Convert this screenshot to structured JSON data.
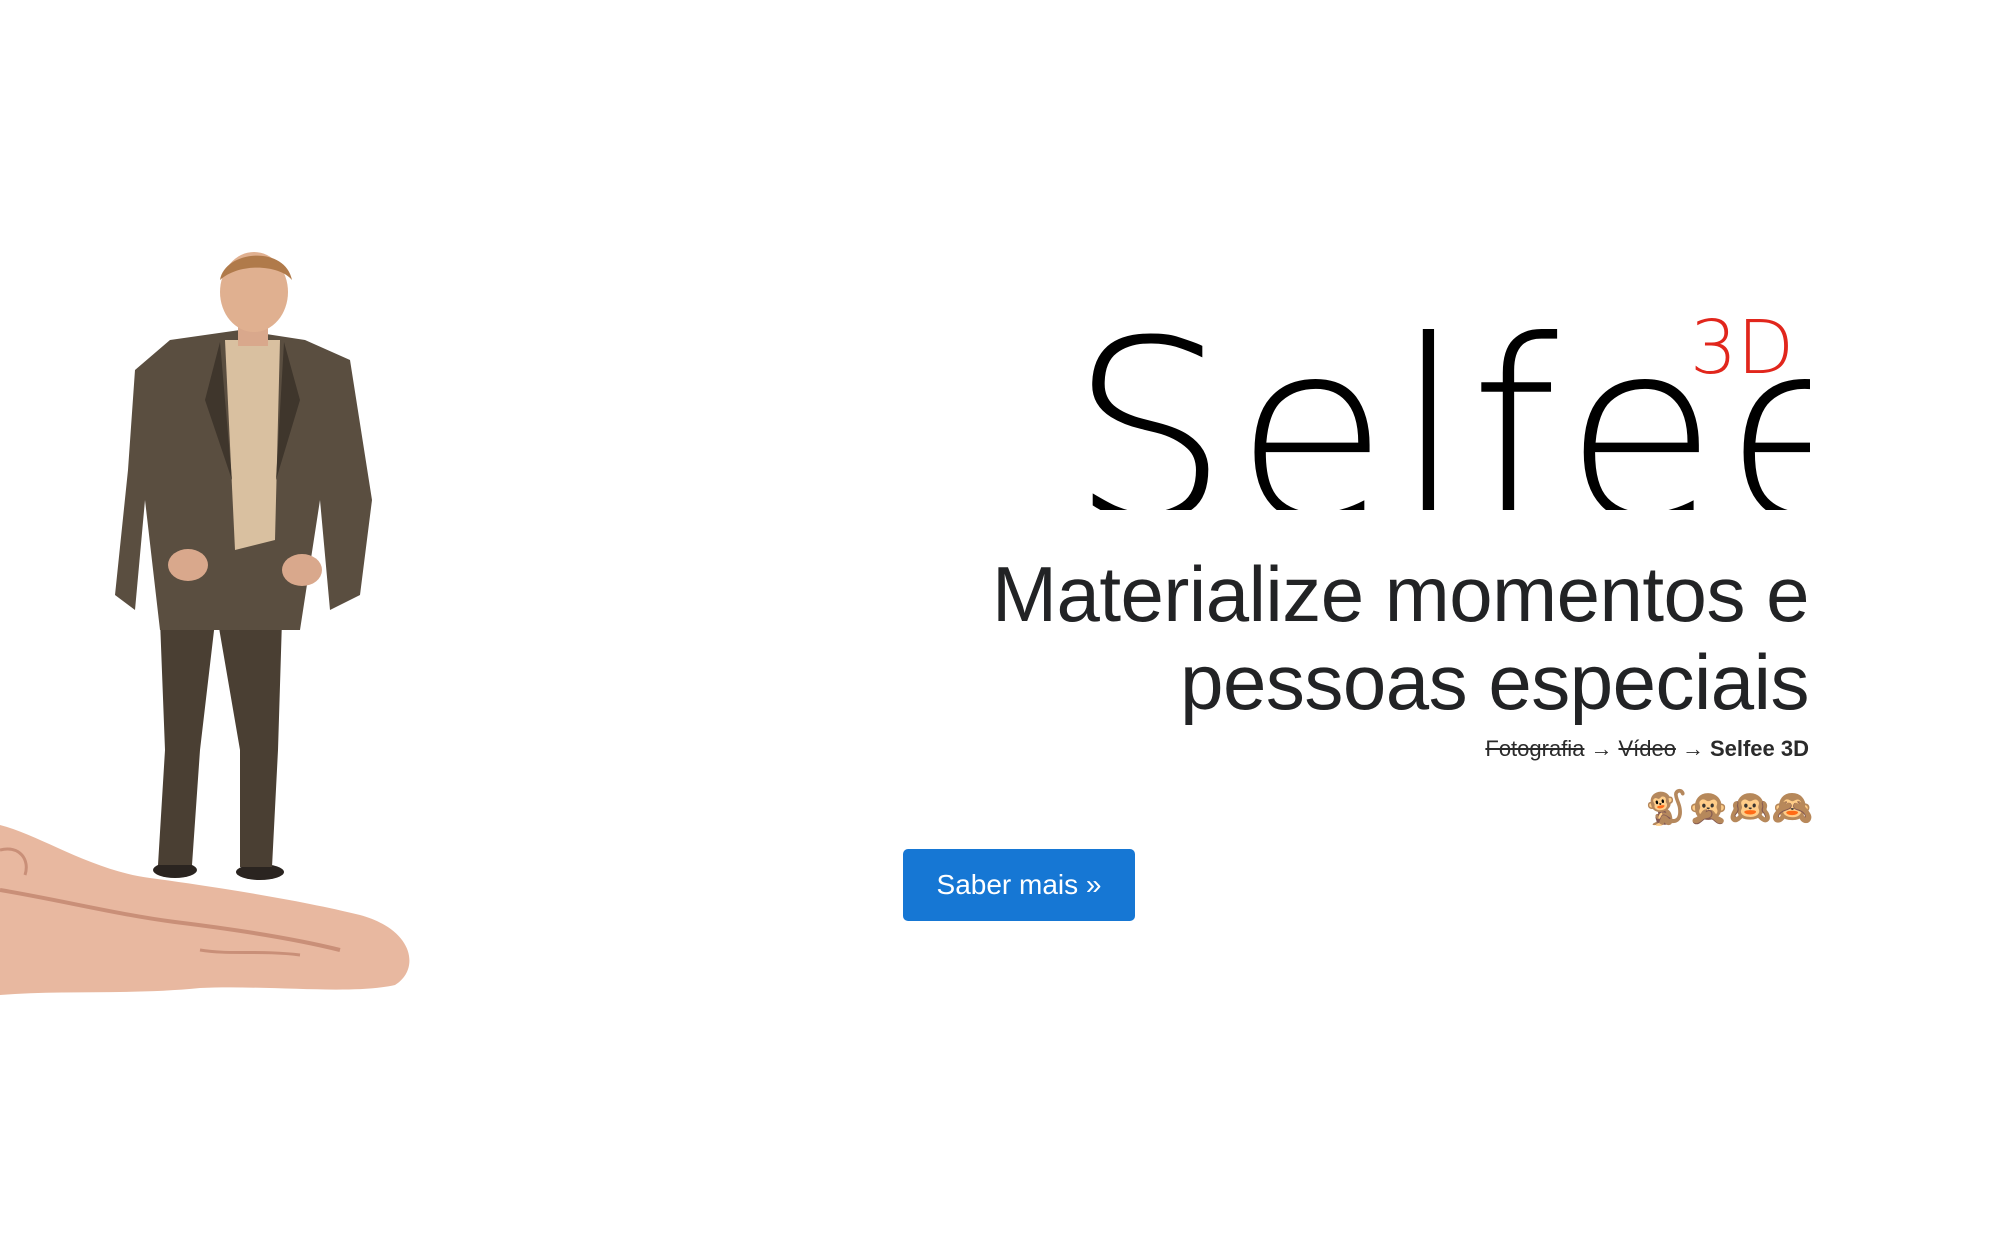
{
  "logo": {
    "word": "Selfee",
    "superscript": "3D",
    "colors": {
      "word": "#000000",
      "superscript": "#e1261c"
    }
  },
  "headline": {
    "line1": "Materialize momentos e",
    "line2": "pessoas especiais"
  },
  "evolution": {
    "step1": "Fotografia",
    "step2": "Vídeo",
    "arrow": "→",
    "current": "Selfee 3D"
  },
  "emojis": [
    "🐒",
    "🙊",
    "🙉",
    "🙈"
  ],
  "cta": {
    "label": "Saber mais »",
    "color": "#1677d4"
  },
  "hero_image": {
    "icon": "person-on-hand-illustration"
  }
}
